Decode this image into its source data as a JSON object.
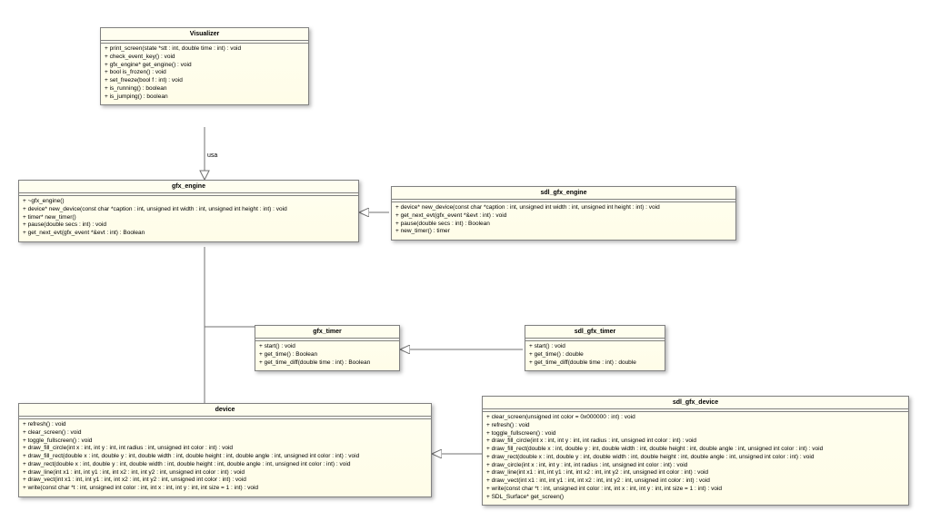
{
  "classes": {
    "visualizer": {
      "name": "Visualizer",
      "methods": [
        "+ print_screen(state *stt : int, double time : int) : void",
        "+ check_event_key() : void",
        "+ gfx_engine* get_engine() : void",
        "+ bool is_frozen() : void",
        "+ set_freeze(bool f : int) : void",
        "+ is_running() : boolean",
        "+ is_jumping() : boolean"
      ]
    },
    "gfx_engine": {
      "name": "gfx_engine",
      "methods": [
        "+ ~gfx_engine()",
        "+ device* new_device(const char *caption : int, unsigned int width : int, unsigned int height : int) : void",
        "+ timer* new_timer()",
        "+ pause(double secs : int) : void",
        "+ get_next_evt(gfx_event *&evt : int) : Boolean"
      ]
    },
    "sdl_gfx_engine": {
      "name": "sdl_gfx_engine",
      "methods": [
        "+ device* new_device(const char *caption : int, unsigned int width : int, unsigned int height : int) : void",
        "+ get_next_evt(gfx_event *&evt : int) : void",
        "+ pause(double secs : int) : Boolean",
        "+ new_timer() : timer"
      ]
    },
    "gfx_timer": {
      "name": "gfx_timer",
      "methods": [
        "+ start() : void",
        "+ get_time() : Boolean",
        "+ get_time_diff(double time : int) : Boolean"
      ]
    },
    "sdl_gfx_timer": {
      "name": "sdl_gfx_timer",
      "methods": [
        "+ start() : void",
        "+ get_time() : double",
        "+ get_time_diff(double time : int) : double"
      ]
    },
    "device": {
      "name": "device",
      "methods": [
        "+ refresh() : void",
        "+ clear_screen() : void",
        "+ toggle_fullscreen() : void",
        "+ draw_fill_circle(int x : int, int y : int, int radius : int, unsigned int color : int) : void",
        "+ draw_fill_rect(double x : int, double y : int, double width : int, double height : int, double angle : int, unsigned int color : int) : void",
        "+ draw_rect(double x : int, double y : int, double width : int, double height : int, double angle : int, unsigned int color : int) : void",
        "+ draw_line(int x1 : int, int y1 : int, int x2 : int, int y2 : int, unsigned int color : int) : void",
        "+ draw_vect(int x1 : int, int y1 : int, int x2 : int, int y2 : int, unsigned int color : int) : void",
        "+ write(const char *t : int, unsigned int color : int, int x : int, int y : int, int size = 1 : int) : void"
      ]
    },
    "sdl_gfx_device": {
      "name": "sdl_gfx_device",
      "methods": [
        "+ clear_screen(unsigned int color = 0x000000 : int) : void",
        "+ refresh() : void",
        "+ toggle_fullscreen() : void",
        "+ draw_fill_circle(int x : int, int y : int, int radius : int, unsigned int color : int) : void",
        "+ draw_fill_rect(double x : int, double y : int, double width : int, double height : int, double angle : int, unsigned int color : int) : void",
        "+ draw_rect(double x : int, double y : int, double width : int, double height : int, double angle : int, unsigned int color : int) : void",
        "+ draw_circle(int x : int, int y : int, int radius : int, unsigned int color : int) : void",
        "+ draw_line(int x1 : int, int y1 : int, int x2 : int, int y2 : int, unsigned int color : int) : void",
        "+ draw_vect(int x1 : int, int y1 : int, int x2 : int, int y2 : int, unsigned int color : int) : void",
        "+ write(const char *t : int, unsigned int color : int, int x : int, int y : int, int size = 1 : int) : void",
        "+ SDL_Surface* get_screen()"
      ]
    }
  },
  "labels": {
    "usa": "usa"
  }
}
